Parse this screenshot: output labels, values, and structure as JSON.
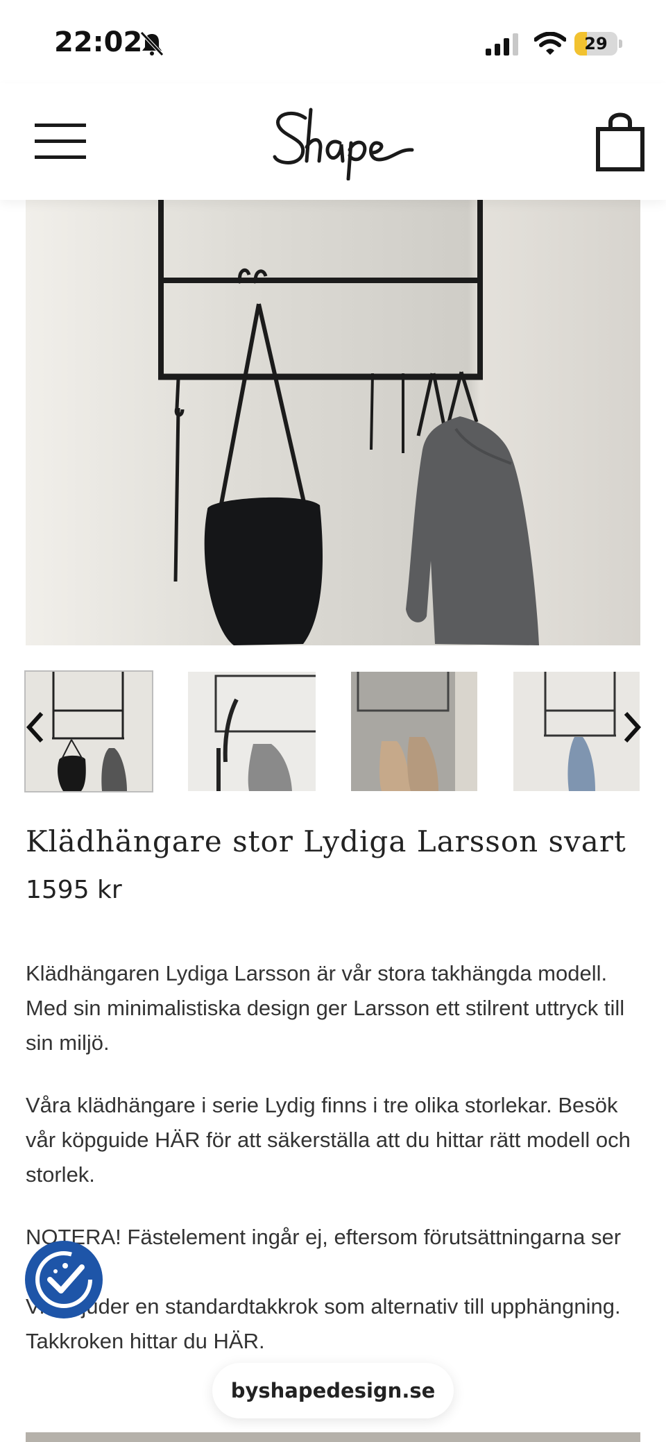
{
  "status_bar": {
    "time": "22:02",
    "battery_level": "29",
    "battery_fraction": 0.29,
    "icons": [
      "bell-muted-icon",
      "signal-icon",
      "wifi-icon",
      "battery-icon"
    ]
  },
  "header": {
    "logo_text": "Shape",
    "icons": [
      "hamburger-menu-icon",
      "shopping-bag-icon"
    ]
  },
  "gallery": {
    "thumbnail_count": 4,
    "active_index": 0,
    "icons": [
      "chevron-left-icon",
      "chevron-right-icon"
    ]
  },
  "product": {
    "title": "Klädhängare stor Lydiga Larsson svart",
    "price": "1595 kr",
    "description": [
      "Klädhängaren Lydiga Larsson är vår stora takhängda modell. Med sin minimalistiska design ger Larsson ett stilrent uttryck till sin miljö.",
      "Våra klädhängare i serie Lydig finns i tre olika storlekar. Besök vår köpguide HÄR för att säkerställa att du hittar rätt modell och storlek.",
      "NOTERA! Fästelement ingår ej, eftersom förutsättningarna ser olika ut",
      "Vi erbjuder en standardtakkrok som alternativ till upphängning. Takkroken hittar du HÄR."
    ]
  },
  "browser": {
    "url": "byshapedesign.se"
  },
  "colors": {
    "accessibility_badge": "#1e55a8",
    "battery_fill": "#f2c230"
  }
}
